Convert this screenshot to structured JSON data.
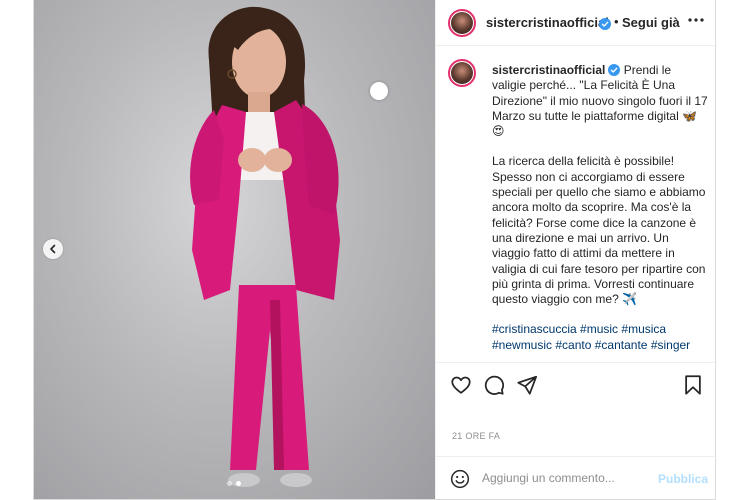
{
  "post": {
    "username": "sistercristinaofficial",
    "follow_separator": "•",
    "follow_label": "Segui già",
    "caption_lead": "Prendi le valigie perché... \"La Felicità È Una Direzione\" il mio nuovo singolo fuori il 17 Marzo su tutte le piattaforme digital",
    "caption_lead_emoji": "🦋 😍",
    "caption_body": "La ricerca della felicità è possibile! Spesso non ci accorgiamo di essere speciali per quello che siamo e abbiamo ancora molto da scoprire. Ma cos'è la felicità? Forse come dice la canzone è una direzione e mai un arrivo. Un viaggio fatto di attimi da mettere in valigia di cui fare tesoro per ripartire con più grinta di prima. Vorresti continuare questo viaggio con me?",
    "caption_body_emoji": "✈️",
    "hashtags": [
      "#cristinascuccia",
      "#music",
      "#musica",
      "#newmusic",
      "#canto",
      "#cantante",
      "#singer"
    ],
    "timestamp": "21 ORE FA",
    "comment_placeholder": "Aggiungi un commento...",
    "publish_label": "Pubblica",
    "carousel": {
      "count": 2,
      "active_index": 1
    }
  },
  "icons": {
    "verified": "verified-badge-icon",
    "more": "more-options-icon",
    "prev": "chevron-left-icon",
    "like": "heart-icon",
    "comment": "comment-icon",
    "share": "send-icon",
    "save": "bookmark-icon",
    "emoji": "smiley-icon"
  },
  "colors": {
    "verified": "#3897f0",
    "link": "#00376b",
    "publish_disabled": "#b2dffc",
    "suit": "#d81b7a",
    "story_ring": "#e1306c"
  }
}
